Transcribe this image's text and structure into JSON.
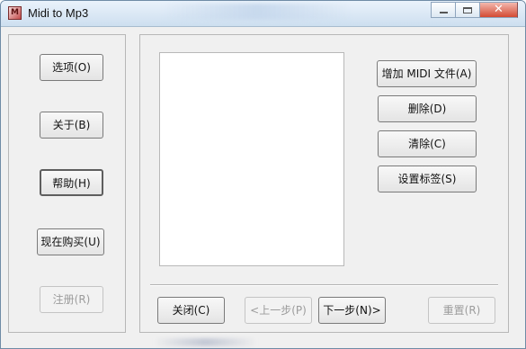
{
  "window": {
    "title": "Midi to Mp3"
  },
  "caption": {
    "close_glyph": "✕"
  },
  "sidebar": {
    "options": "选项(O)",
    "about": "关于(B)",
    "help": "帮助(H)",
    "buy": "现在购买(U)",
    "register": "注册(R)"
  },
  "actions": {
    "add_midi": "增加 MIDI 文件(A)",
    "delete": "删除(D)",
    "clear": "清除(C)",
    "set_tags": "设置标签(S)"
  },
  "nav": {
    "close": "关闭(C)",
    "prev": "<上一步(P)",
    "next": "下一步(N)>",
    "reset": "重置(R)"
  },
  "file_list": {
    "items": []
  }
}
